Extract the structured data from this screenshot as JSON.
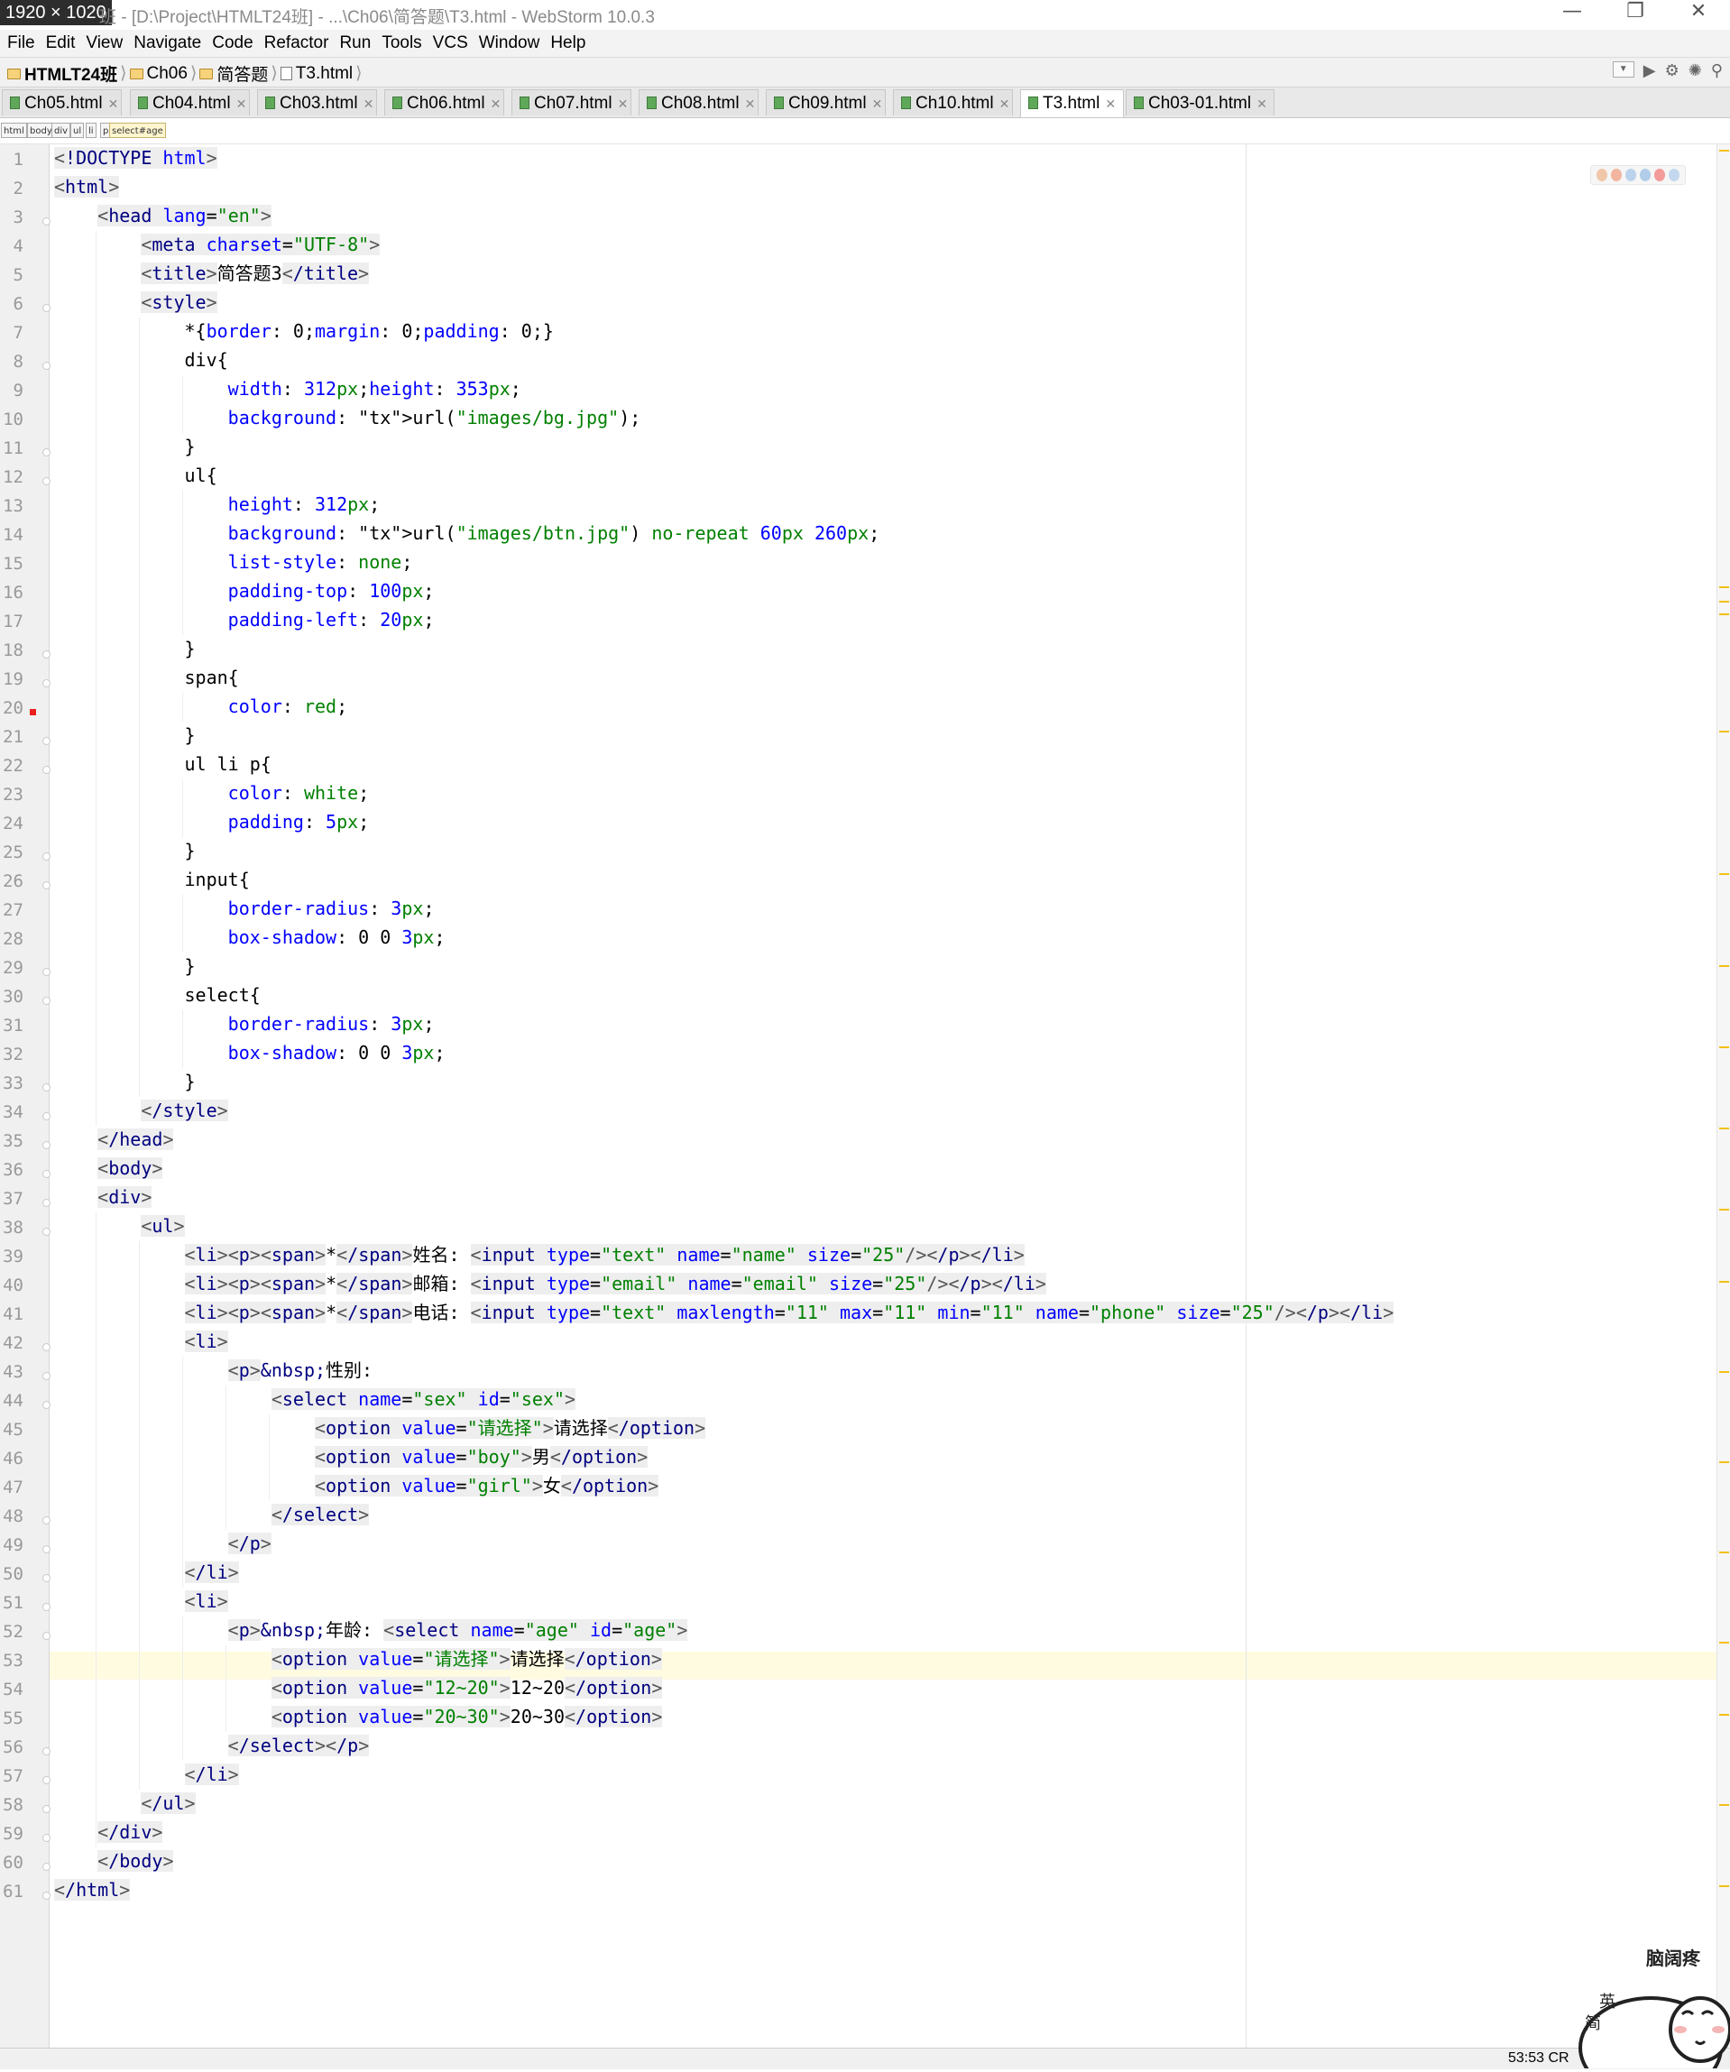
{
  "window": {
    "dimensions_badge": "1920 × 1020",
    "title": "班 - [D:\\Project\\HTMLT24班] - ...\\Ch06\\简答题\\T3.html - WebStorm 10.0.3"
  },
  "menu": [
    "File",
    "Edit",
    "View",
    "Navigate",
    "Code",
    "Refactor",
    "Run",
    "Tools",
    "VCS",
    "Window",
    "Help"
  ],
  "breadcrumbs": [
    "HTMLT24班",
    "Ch06",
    "简答题",
    "T3.html"
  ],
  "tabs": [
    "Ch05.html",
    "Ch04.html",
    "Ch03.html",
    "Ch06.html",
    "Ch07.html",
    "Ch08.html",
    "Ch09.html",
    "Ch10.html",
    "T3.html",
    "Ch03-01.html"
  ],
  "active_tab": "T3.html",
  "tag_path": [
    "html",
    "body",
    "div",
    "ul",
    "li",
    "p",
    "select#age"
  ],
  "line_numbers": [
    "1",
    "2",
    "3",
    "4",
    "5",
    "6",
    "7",
    "8",
    "9",
    "10",
    "11",
    "12",
    "13",
    "14",
    "15",
    "16",
    "17",
    "18",
    "19",
    "20",
    "21",
    "22",
    "23",
    "24",
    "25",
    "26",
    "27",
    "28",
    "29",
    "30",
    "31",
    "32",
    "33",
    "34",
    "35",
    "36",
    "37",
    "38",
    "39",
    "40",
    "41",
    "42",
    "43",
    "44",
    "45",
    "46",
    "47",
    "48",
    "49",
    "50",
    "51",
    "52",
    "53",
    "54",
    "55",
    "56",
    "57",
    "58",
    "59",
    "60",
    "61"
  ],
  "code_lines": [
    "<!DOCTYPE html>",
    "<html>",
    "    <head lang=\"en\">",
    "        <meta charset=\"UTF-8\">",
    "        <title>简答题3</title>",
    "        <style>",
    "            *{border: 0;margin: 0;padding: 0;}",
    "            div{",
    "                width: 312px;height: 353px;",
    "                background: url(\"images/bg.jpg\");",
    "            }",
    "            ul{",
    "                height: 312px;",
    "                background: url(\"images/btn.jpg\") no-repeat 60px 260px;",
    "                list-style: none;",
    "                padding-top: 100px;",
    "                padding-left: 20px;",
    "            }",
    "            span{",
    "                color: red;",
    "            }",
    "            ul li p{",
    "                color: white;",
    "                padding: 5px;",
    "            }",
    "            input{",
    "                border-radius: 3px;",
    "                box-shadow: 0 0 3px;",
    "            }",
    "            select{",
    "                border-radius: 3px;",
    "                box-shadow: 0 0 3px;",
    "            }",
    "        </style>",
    "    </head>",
    "    <body>",
    "    <div>",
    "        <ul>",
    "            <li><p><span>*</span>姓名: <input type=\"text\" name=\"name\" size=\"25\"/></p></li>",
    "            <li><p><span>*</span>邮箱: <input type=\"email\" name=\"email\" size=\"25\"/></p></li>",
    "            <li><p><span>*</span>电话: <input type=\"text\" maxlength=\"11\" max=\"11\" min=\"11\" name=\"phone\" size=\"25\"/></p></li>",
    "            <li>",
    "                <p>&nbsp;性别:",
    "                    <select name=\"sex\" id=\"sex\">",
    "                        <option value=\"请选择\">请选择</option>",
    "                        <option value=\"boy\">男</option>",
    "                        <option value=\"girl\">女</option>",
    "                    </select>",
    "                </p>",
    "            </li>",
    "            <li>",
    "                <p>&nbsp;年龄: <select name=\"age\" id=\"age\">",
    "                    <option value=\"请选择\">请选择</option>",
    "                    <option value=\"12~20\">12~20</option>",
    "                    <option value=\"20~30\">20~30</option>",
    "                </select></p>",
    "            </li>",
    "        </ul>",
    "    </div>",
    "    </body>",
    "</html>"
  ],
  "current_line": "53",
  "breakpoint_line": "20",
  "status": {
    "position": "53:53",
    "line_sep": "CR"
  },
  "sticker": {
    "caption": "脑阔疼",
    "lines": [
      "英",
      "简"
    ]
  },
  "colors": {
    "tag": "#000080",
    "attr": "#0000ff",
    "string": "#008000",
    "current_line_bg": "#fffbe1"
  }
}
